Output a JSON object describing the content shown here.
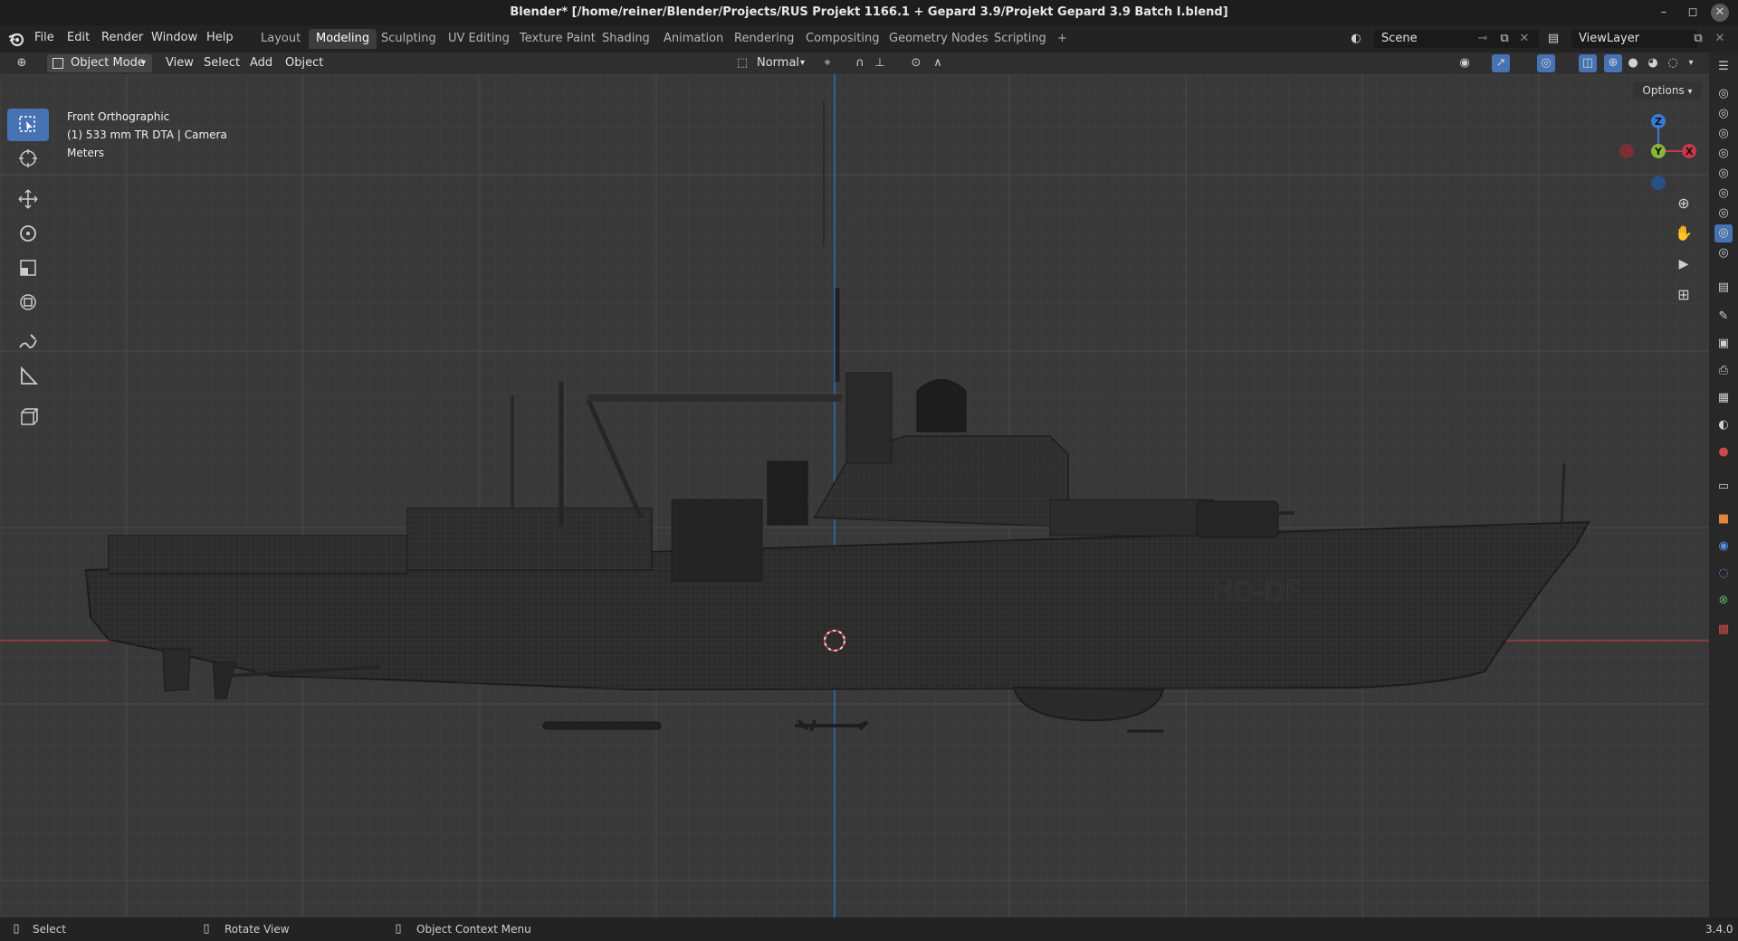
{
  "window": {
    "title": "Blender* [/home/reiner/Blender/Projects/RUS Projekt 1166.1 + Gepard 3.9/Projekt Gepard 3.9 Batch I.blend]",
    "minimize": "–",
    "maximize": "◻",
    "close": "✕"
  },
  "menubar": {
    "items": [
      "File",
      "Edit",
      "Render",
      "Window",
      "Help"
    ],
    "workspaces": [
      "Layout",
      "Modeling",
      "Sculpting",
      "UV Editing",
      "Texture Paint",
      "Shading",
      "Animation",
      "Rendering",
      "Compositing",
      "Geometry Nodes",
      "Scripting"
    ],
    "active_workspace": "Modeling",
    "add_tab": "+",
    "scene": "Scene",
    "view_layer": "ViewLayer"
  },
  "header": {
    "mode": "Object Mode",
    "menus": [
      "View",
      "Select",
      "Add",
      "Object"
    ],
    "transform_orientation": "Normal",
    "options": "Options"
  },
  "viewport": {
    "view_name": "Front Orthographic",
    "collection_info": "(1) 533 mm TR DTA | Camera",
    "units": "Meters",
    "gizmo_axes": {
      "z": "Z",
      "y": "Y",
      "x": "X"
    },
    "hull_marking": "HD-DF"
  },
  "statusbar": {
    "select": "Select",
    "rotate_view": "Rotate View",
    "context_menu": "Object Context Menu",
    "version": "3.4.0"
  },
  "colors": {
    "accent": "#4772b3",
    "x_axis": "#c4384a",
    "y_axis": "#8ab53a",
    "z_axis": "#3a7ad6"
  }
}
